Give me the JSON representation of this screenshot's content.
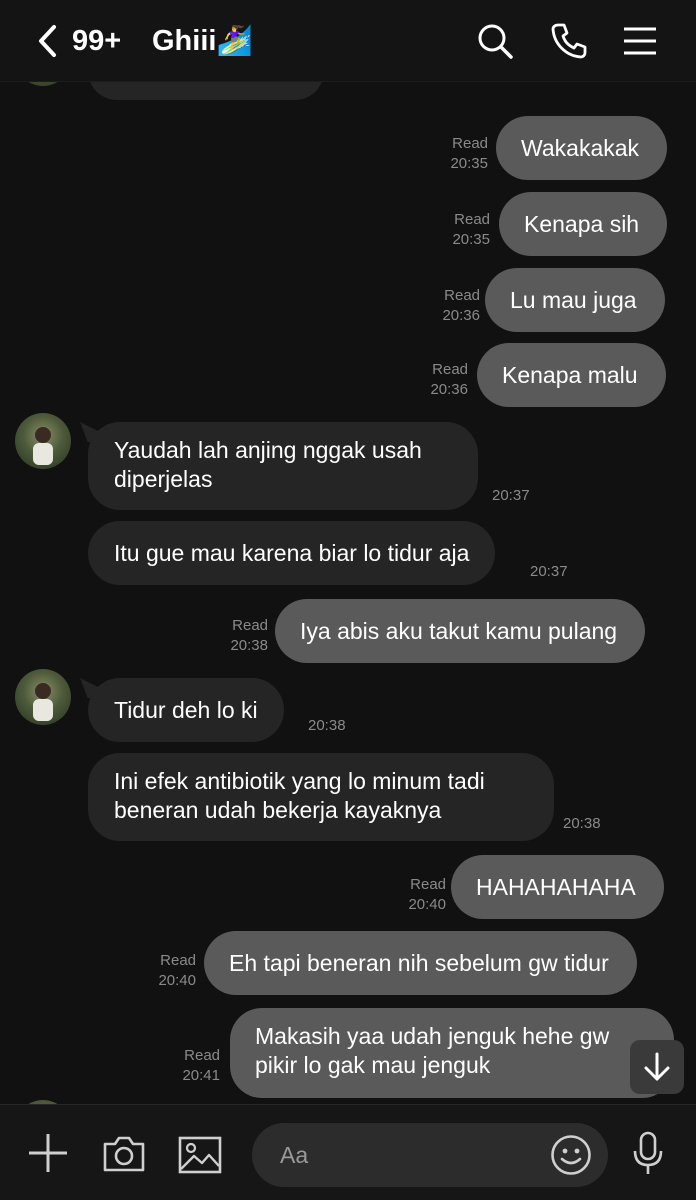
{
  "header": {
    "unread_count": "99+",
    "chat_name": "Ghiii",
    "chat_emoji": "🏄‍♀️",
    "icons": [
      "chevron-left-icon",
      "search-icon",
      "phone-icon",
      "menu-icon"
    ]
  },
  "messages": [
    {
      "dir": "out",
      "text": "Wakakakak",
      "read": "Read",
      "time": "20:35"
    },
    {
      "dir": "out",
      "text": "Kenapa sih",
      "read": "Read",
      "time": "20:35"
    },
    {
      "dir": "out",
      "text": "Lu mau juga",
      "read": "Read",
      "time": "20:36"
    },
    {
      "dir": "out",
      "text": "Kenapa malu",
      "read": "Read",
      "time": "20:36"
    },
    {
      "dir": "in",
      "lines": [
        "Yaudah lah anjing nggak usah",
        "diperjelas"
      ],
      "time": "20:37"
    },
    {
      "dir": "in",
      "text": "Itu gue mau karena biar lo tidur aja",
      "time": "20:37"
    },
    {
      "dir": "out",
      "text": "Iya abis aku takut kamu pulang",
      "read": "Read",
      "time": "20:38"
    },
    {
      "dir": "in",
      "text": "Tidur deh lo ki",
      "time": "20:38"
    },
    {
      "dir": "in",
      "lines": [
        "Ini efek antibiotik yang lo minum tadi",
        "beneran udah bekerja kayaknya"
      ],
      "time": "20:38"
    },
    {
      "dir": "out",
      "text": "HAHAHAHAHA",
      "read": "Read",
      "time": "20:40"
    },
    {
      "dir": "out",
      "text": "Eh tapi beneran nih sebelum gw tidur",
      "read": "Read",
      "time": "20:40"
    },
    {
      "dir": "out",
      "lines": [
        "Makasih yaa udah jenguk hehe gw",
        "pikir lo gak mau jenguk"
      ],
      "read": "Read",
      "time": "20:41"
    }
  ],
  "composer": {
    "placeholder": "Aa",
    "icons": [
      "plus-icon",
      "camera-icon",
      "image-icon",
      "emoji-icon",
      "microphone-icon"
    ]
  },
  "colors": {
    "background": "#111111",
    "outgoing_bubble": "#5a5a5a",
    "incoming_bubble": "#252525",
    "meta_text": "#8a8a8a"
  }
}
